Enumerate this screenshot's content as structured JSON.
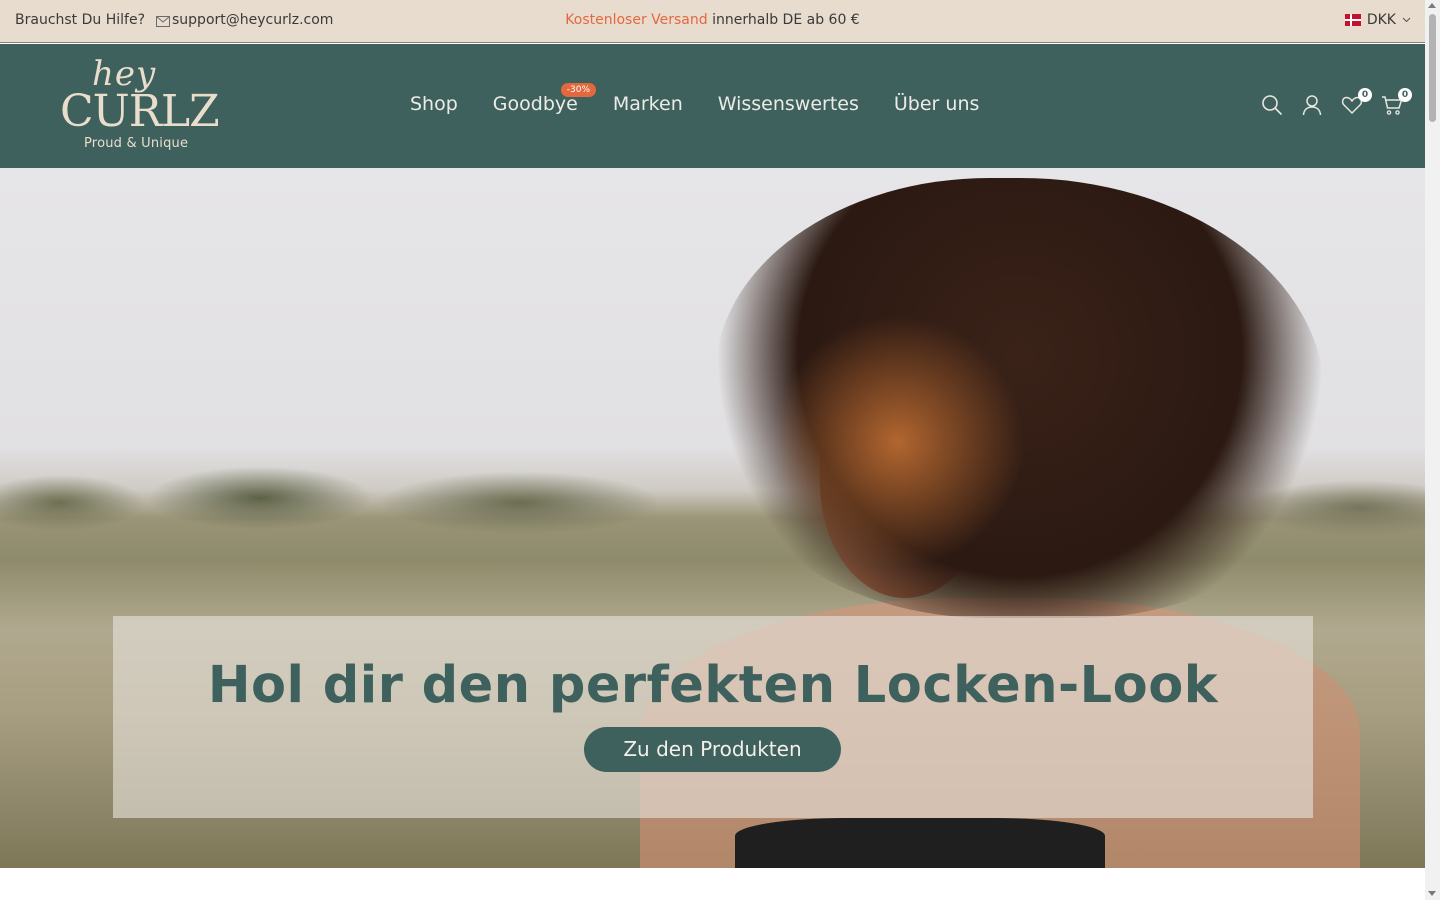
{
  "topbar": {
    "help_text": "Brauchst Du Hilfe?",
    "email": "support@heycurlz.com",
    "promo_highlight": "Kostenloser Versand",
    "promo_rest": " innerhalb DE ab 60 €",
    "currency": "DKK"
  },
  "brand": {
    "logo_script": "hey",
    "logo_main": "CURLZ",
    "tagline": "Proud & Unique"
  },
  "nav": {
    "items": [
      {
        "label": "Shop"
      },
      {
        "label": "Goodbye",
        "badge": "-30%"
      },
      {
        "label": "Marken"
      },
      {
        "label": "Wissenswertes"
      },
      {
        "label": "Über uns"
      }
    ]
  },
  "header_icons": {
    "wishlist_count": "0",
    "cart_count": "0"
  },
  "hero": {
    "headline": "Hol dir den perfekten Locken-Look",
    "cta_label": "Zu den Produkten"
  },
  "colors": {
    "brand_green": "#3f615d",
    "accent_orange": "#e4683e",
    "topbar_bg": "#e8dccf"
  }
}
